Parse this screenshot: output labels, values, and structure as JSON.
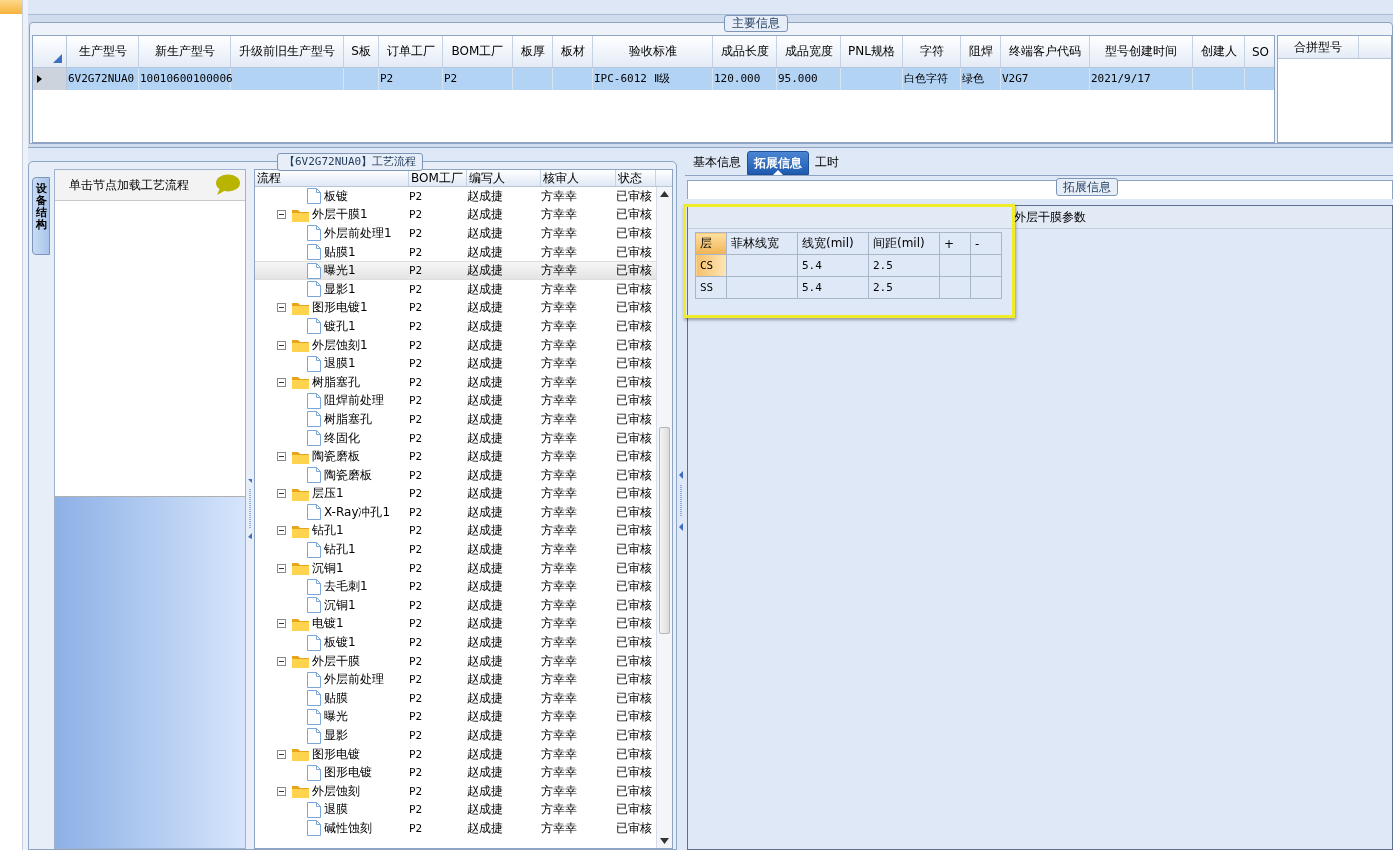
{
  "main_info": {
    "title": "主要信息",
    "columns": [
      "生产型号",
      "新生产型号",
      "升级前旧生产型号",
      "S板",
      "订单工厂",
      "BOM工厂",
      "板厚",
      "板材",
      "验收标准",
      "成品长度",
      "成品宽度",
      "PNL规格",
      "字符",
      "阻焊",
      "终端客户代码",
      "型号创建时间",
      "创建人",
      "SO"
    ],
    "rows": [
      {
        "selected": true,
        "cells": [
          "6V2G72NUA0",
          "10010600100006",
          null,
          null,
          "P2",
          "P2",
          null,
          null,
          "IPC-6012 Ⅱ级",
          "120.000",
          "95.000",
          null,
          "白色字符",
          "绿色",
          "V2G7",
          "2021/9/17",
          null,
          null
        ]
      }
    ]
  },
  "merge_panel": {
    "column": "合拼型号"
  },
  "flow": {
    "title": "【6V2G72NUA0】工艺流程",
    "side_tab": "设备结构",
    "hint": "单击节点加载工艺流程",
    "columns": [
      "流程",
      "BOM工厂",
      "编写人",
      "核审人",
      "状态"
    ],
    "tree": [
      {
        "name": "板镀",
        "bom": "P2",
        "writer": "赵成捷",
        "reviewer": "方幸幸",
        "status": "已审核",
        "selected": false
      },
      {
        "name": "外层干膜1",
        "bom": "P2",
        "writer": "赵成捷",
        "reviewer": "方幸幸",
        "status": "已审核",
        "selected": false,
        "expanded": true,
        "children": [
          {
            "name": "外层前处理1",
            "bom": "P2",
            "writer": "赵成捷",
            "reviewer": "方幸幸",
            "status": "已审核",
            "selected": false
          },
          {
            "name": "贴膜1",
            "bom": "P2",
            "writer": "赵成捷",
            "reviewer": "方幸幸",
            "status": "已审核",
            "selected": false
          },
          {
            "name": "曝光1",
            "bom": "P2",
            "writer": "赵成捷",
            "reviewer": "方幸幸",
            "status": "已审核",
            "selected": true
          },
          {
            "name": "显影1",
            "bom": "P2",
            "writer": "赵成捷",
            "reviewer": "方幸幸",
            "status": "已审核",
            "selected": false
          }
        ]
      },
      {
        "name": "图形电镀1",
        "bom": "P2",
        "writer": "赵成捷",
        "reviewer": "方幸幸",
        "status": "已审核",
        "selected": false,
        "expanded": true,
        "children": [
          {
            "name": "镀孔1",
            "bom": "P2",
            "writer": "赵成捷",
            "reviewer": "方幸幸",
            "status": "已审核",
            "selected": false
          }
        ]
      },
      {
        "name": "外层蚀刻1",
        "bom": "P2",
        "writer": "赵成捷",
        "reviewer": "方幸幸",
        "status": "已审核",
        "selected": false,
        "expanded": true,
        "children": [
          {
            "name": "退膜1",
            "bom": "P2",
            "writer": "赵成捷",
            "reviewer": "方幸幸",
            "status": "已审核",
            "selected": false
          }
        ]
      },
      {
        "name": "树脂塞孔",
        "bom": "P2",
        "writer": "赵成捷",
        "reviewer": "方幸幸",
        "status": "已审核",
        "selected": false,
        "expanded": true,
        "children": [
          {
            "name": "阻焊前处理",
            "bom": "P2",
            "writer": "赵成捷",
            "reviewer": "方幸幸",
            "status": "已审核",
            "selected": false
          },
          {
            "name": "树脂塞孔",
            "bom": "P2",
            "writer": "赵成捷",
            "reviewer": "方幸幸",
            "status": "已审核",
            "selected": false
          },
          {
            "name": "终固化",
            "bom": "P2",
            "writer": "赵成捷",
            "reviewer": "方幸幸",
            "status": "已审核",
            "selected": false
          }
        ]
      },
      {
        "name": "陶瓷磨板",
        "bom": "P2",
        "writer": "赵成捷",
        "reviewer": "方幸幸",
        "status": "已审核",
        "selected": false,
        "expanded": true,
        "children": [
          {
            "name": "陶瓷磨板",
            "bom": "P2",
            "writer": "赵成捷",
            "reviewer": "方幸幸",
            "status": "已审核",
            "selected": false
          }
        ]
      },
      {
        "name": "层压1",
        "bom": "P2",
        "writer": "赵成捷",
        "reviewer": "方幸幸",
        "status": "已审核",
        "selected": false,
        "expanded": true,
        "children": [
          {
            "name": "X-Ray冲孔1",
            "bom": "P2",
            "writer": "赵成捷",
            "reviewer": "方幸幸",
            "status": "已审核",
            "selected": false
          }
        ]
      },
      {
        "name": "钻孔1",
        "bom": "P2",
        "writer": "赵成捷",
        "reviewer": "方幸幸",
        "status": "已审核",
        "selected": false,
        "expanded": true,
        "children": [
          {
            "name": "钻孔1",
            "bom": "P2",
            "writer": "赵成捷",
            "reviewer": "方幸幸",
            "status": "已审核",
            "selected": false
          }
        ]
      },
      {
        "name": "沉铜1",
        "bom": "P2",
        "writer": "赵成捷",
        "reviewer": "方幸幸",
        "status": "已审核",
        "selected": false,
        "expanded": true,
        "children": [
          {
            "name": "去毛刺1",
            "bom": "P2",
            "writer": "赵成捷",
            "reviewer": "方幸幸",
            "status": "已审核",
            "selected": false
          },
          {
            "name": "沉铜1",
            "bom": "P2",
            "writer": "赵成捷",
            "reviewer": "方幸幸",
            "status": "已审核",
            "selected": false
          }
        ]
      },
      {
        "name": "电镀1",
        "bom": "P2",
        "writer": "赵成捷",
        "reviewer": "方幸幸",
        "status": "已审核",
        "selected": false,
        "expanded": true,
        "children": [
          {
            "name": "板镀1",
            "bom": "P2",
            "writer": "赵成捷",
            "reviewer": "方幸幸",
            "status": "已审核",
            "selected": false
          }
        ]
      },
      {
        "name": "外层干膜",
        "bom": "P2",
        "writer": "赵成捷",
        "reviewer": "方幸幸",
        "status": "已审核",
        "selected": false,
        "expanded": true,
        "children": [
          {
            "name": "外层前处理",
            "bom": "P2",
            "writer": "赵成捷",
            "reviewer": "方幸幸",
            "status": "已审核",
            "selected": false
          },
          {
            "name": "贴膜",
            "bom": "P2",
            "writer": "赵成捷",
            "reviewer": "方幸幸",
            "status": "已审核",
            "selected": false
          },
          {
            "name": "曝光",
            "bom": "P2",
            "writer": "赵成捷",
            "reviewer": "方幸幸",
            "status": "已审核",
            "selected": false
          },
          {
            "name": "显影",
            "bom": "P2",
            "writer": "赵成捷",
            "reviewer": "方幸幸",
            "status": "已审核",
            "selected": false
          }
        ]
      },
      {
        "name": "图形电镀",
        "bom": "P2",
        "writer": "赵成捷",
        "reviewer": "方幸幸",
        "status": "已审核",
        "selected": false,
        "expanded": true,
        "children": [
          {
            "name": "图形电镀",
            "bom": "P2",
            "writer": "赵成捷",
            "reviewer": "方幸幸",
            "status": "已审核",
            "selected": false
          }
        ]
      },
      {
        "name": "外层蚀刻",
        "bom": "P2",
        "writer": "赵成捷",
        "reviewer": "方幸幸",
        "status": "已审核",
        "selected": false,
        "expanded": true,
        "children": [
          {
            "name": "退膜",
            "bom": "P2",
            "writer": "赵成捷",
            "reviewer": "方幸幸",
            "status": "已审核",
            "selected": false
          },
          {
            "name": "碱性蚀刻",
            "bom": "P2",
            "writer": "赵成捷",
            "reviewer": "方幸幸",
            "status": "已审核",
            "selected": false
          }
        ]
      }
    ]
  },
  "detail": {
    "tabs": [
      {
        "label": "基本信息",
        "selected": false
      },
      {
        "label": "拓展信息",
        "selected": true
      },
      {
        "label": "工时",
        "selected": false
      }
    ],
    "group_title": "拓展信息",
    "section_title": "外层干膜参数",
    "columns": [
      "层",
      "菲林线宽",
      "线宽(mil)",
      "间距(mil)",
      "+",
      "-"
    ],
    "rows": [
      {
        "selected": true,
        "cells": [
          "CS",
          null,
          "5.4",
          "2.5",
          null,
          null
        ]
      },
      {
        "selected": false,
        "cells": [
          "SS",
          null,
          "5.4",
          "2.5",
          null,
          null
        ]
      }
    ]
  }
}
